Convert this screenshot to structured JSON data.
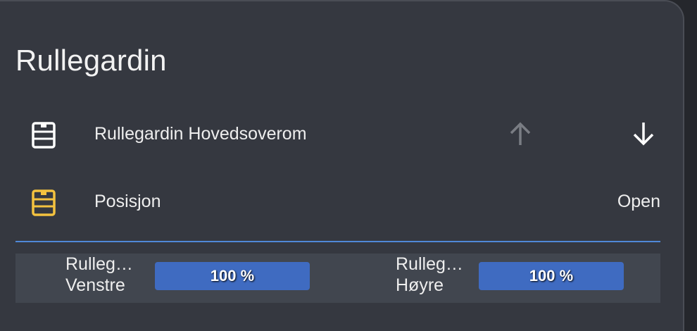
{
  "card": {
    "title": "Rullegardin"
  },
  "cover_row": {
    "icon": "window-shutter-icon",
    "label": "Rullegardin Hovedsoverom",
    "up_icon": "arrow-up-icon",
    "down_icon": "arrow-down-icon"
  },
  "position_row": {
    "icon": "window-shutter-icon",
    "label": "Posisjon",
    "state": "Open"
  },
  "sliders": [
    {
      "line1": "Rulleg…",
      "line2": "Venstre",
      "value_text": "100 %",
      "value": 100
    },
    {
      "line1": "Rulleg…",
      "line2": "Høyre",
      "value_text": "100 %",
      "value": 100
    }
  ],
  "colors": {
    "accent": "#4f88d8",
    "bar": "#3f6bc1",
    "icon_active": "#f4c23f",
    "icon_default": "#ffffff",
    "disabled": "#7a7d84"
  }
}
